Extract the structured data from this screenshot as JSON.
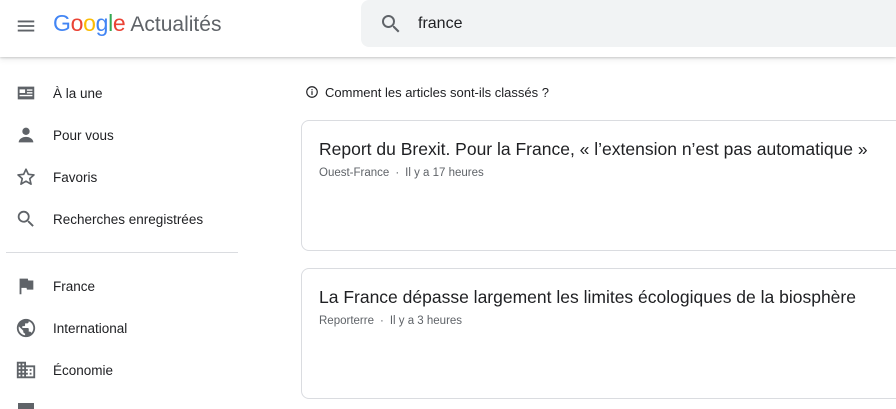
{
  "app": {
    "logo_letters": [
      {
        "ch": "G",
        "color": "#4285F4"
      },
      {
        "ch": "o",
        "color": "#EA4335"
      },
      {
        "ch": "o",
        "color": "#FBBC05"
      },
      {
        "ch": "g",
        "color": "#4285F4"
      },
      {
        "ch": "l",
        "color": "#34A853"
      },
      {
        "ch": "e",
        "color": "#EA4335"
      }
    ],
    "product_name": "Actualités"
  },
  "search": {
    "value": "france"
  },
  "sidebar": {
    "items": [
      {
        "label": "À la une",
        "icon": "newspaper-icon"
      },
      {
        "label": "Pour vous",
        "icon": "person-icon"
      },
      {
        "label": "Favoris",
        "icon": "star-icon"
      },
      {
        "label": "Recherches enregistrées",
        "icon": "search-icon"
      },
      {
        "label": "France",
        "icon": "flag-icon"
      },
      {
        "label": "International",
        "icon": "globe-icon"
      },
      {
        "label": "Économie",
        "icon": "building-icon"
      }
    ]
  },
  "main": {
    "how_ranked": "Comment les articles sont-ils classés ?",
    "articles": [
      {
        "title": "Report du Brexit. Pour la France, « l’extension n’est pas automatique »",
        "source": "Ouest-France",
        "time": "Il y a 17 heures"
      },
      {
        "title": "La France dépasse largement les limites écologiques de la biosphère",
        "source": "Reporterre",
        "time": "Il y a 3 heures"
      }
    ]
  },
  "colors": {
    "icon_gray": "#5f6368",
    "text_dark": "#202124",
    "search_bg": "#f1f3f4",
    "border": "#dadce0"
  }
}
